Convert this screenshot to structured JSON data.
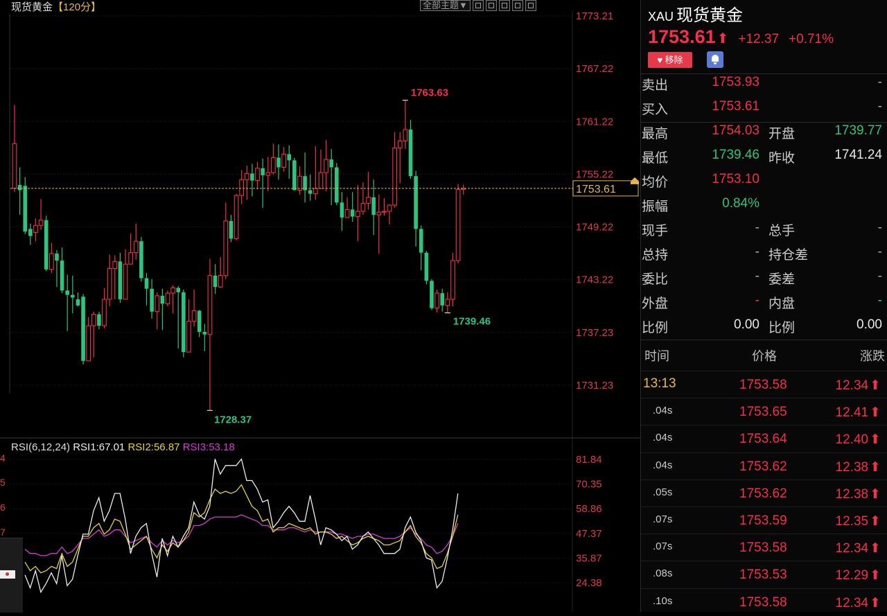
{
  "chart_header": {
    "title": "现货黄金",
    "period": "【120分】",
    "theme_button": "全部主题▼"
  },
  "price_axis_labels": [
    "1773.21",
    "1767.22",
    "1761.22",
    "1755.22",
    "1749.22",
    "1743.22",
    "1737.23",
    "1731.23"
  ],
  "current_price_tag": "1753.61",
  "rsi": {
    "legend": {
      "params": "RSI(6,12,24)",
      "rsi1": "RSI1:67.01",
      "rsi2": "RSI2:56.87",
      "rsi3": "RSI3:53.18"
    },
    "axis_labels": [
      "81.84",
      "70.35",
      "58.86",
      "47.37",
      "35.87",
      "24.38"
    ],
    "cut_left_digits": [
      "4",
      "5",
      "6",
      "7"
    ]
  },
  "chart_data": {
    "type": "candlestick",
    "ylim": [
      1728.0,
      1773.21
    ],
    "current_price": 1753.61,
    "annotations": {
      "high": 1763.63,
      "low": 1728.37,
      "last_low": 1739.46
    },
    "candles": [
      {
        "o": 1753.61,
        "c": 1758.7,
        "h": 1763.1,
        "l": 1753.2
      },
      {
        "o": 1754.0,
        "c": 1753.4,
        "h": 1756.0,
        "l": 1750.6
      },
      {
        "o": 1753.9,
        "c": 1748.7,
        "h": 1754.9,
        "l": 1748.4
      },
      {
        "o": 1749.0,
        "c": 1748.2,
        "h": 1749.6,
        "l": 1747.2
      },
      {
        "o": 1748.6,
        "c": 1749.4,
        "h": 1750.2,
        "l": 1747.6
      },
      {
        "o": 1749.4,
        "c": 1750.0,
        "h": 1752.4,
        "l": 1748.9
      },
      {
        "o": 1750.0,
        "c": 1744.4,
        "h": 1750.5,
        "l": 1744.2
      },
      {
        "o": 1744.4,
        "c": 1746.2,
        "h": 1747.4,
        "l": 1744.0
      },
      {
        "o": 1746.2,
        "c": 1745.4,
        "h": 1746.6,
        "l": 1742.4
      },
      {
        "o": 1745.4,
        "c": 1742.0,
        "h": 1746.9,
        "l": 1741.7
      },
      {
        "o": 1742.0,
        "c": 1741.5,
        "h": 1743.8,
        "l": 1737.4
      },
      {
        "o": 1741.5,
        "c": 1741.2,
        "h": 1743.7,
        "l": 1739.4
      },
      {
        "o": 1741.0,
        "c": 1740.3,
        "h": 1741.8,
        "l": 1740.2
      },
      {
        "o": 1741.3,
        "c": 1734.0,
        "h": 1741.6,
        "l": 1733.6
      },
      {
        "o": 1734.0,
        "c": 1738.0,
        "h": 1739.0,
        "l": 1734.3
      },
      {
        "o": 1738.0,
        "c": 1739.3,
        "h": 1739.6,
        "l": 1734.4
      },
      {
        "o": 1739.3,
        "c": 1738.0,
        "h": 1739.6,
        "l": 1737.6
      },
      {
        "o": 1738.0,
        "c": 1741.0,
        "h": 1742.3,
        "l": 1737.7
      },
      {
        "o": 1741.0,
        "c": 1744.5,
        "h": 1746.1,
        "l": 1740.2
      },
      {
        "o": 1744.5,
        "c": 1745.3,
        "h": 1746.0,
        "l": 1741.0
      },
      {
        "o": 1745.3,
        "c": 1741.0,
        "h": 1746.3,
        "l": 1740.6
      },
      {
        "o": 1741.0,
        "c": 1745.0,
        "h": 1746.7,
        "l": 1741.1
      },
      {
        "o": 1745.0,
        "c": 1746.3,
        "h": 1748.5,
        "l": 1745.0
      },
      {
        "o": 1746.3,
        "c": 1747.6,
        "h": 1749.6,
        "l": 1745.5
      },
      {
        "o": 1747.6,
        "c": 1743.4,
        "h": 1748.1,
        "l": 1743.0
      },
      {
        "o": 1743.4,
        "c": 1742.2,
        "h": 1744.0,
        "l": 1740.3
      },
      {
        "o": 1742.2,
        "c": 1739.6,
        "h": 1743.3,
        "l": 1738.8
      },
      {
        "o": 1739.6,
        "c": 1741.4,
        "h": 1741.8,
        "l": 1737.6
      },
      {
        "o": 1741.4,
        "c": 1740.5,
        "h": 1742.2,
        "l": 1737.5
      },
      {
        "o": 1740.5,
        "c": 1741.7,
        "h": 1742.0,
        "l": 1740.2
      },
      {
        "o": 1741.7,
        "c": 1742.3,
        "h": 1742.6,
        "l": 1739.4
      },
      {
        "o": 1742.3,
        "c": 1741.8,
        "h": 1742.5,
        "l": 1735.4
      },
      {
        "o": 1741.8,
        "c": 1735.0,
        "h": 1742.1,
        "l": 1734.4
      },
      {
        "o": 1735.0,
        "c": 1738.5,
        "h": 1741.0,
        "l": 1735.0
      },
      {
        "o": 1738.5,
        "c": 1739.7,
        "h": 1742.1,
        "l": 1737.9
      },
      {
        "o": 1739.7,
        "c": 1737.3,
        "h": 1739.8,
        "l": 1736.7
      },
      {
        "o": 1737.3,
        "c": 1737.0,
        "h": 1738.2,
        "l": 1735.1
      },
      {
        "o": 1737.0,
        "c": 1743.7,
        "h": 1745.6,
        "l": 1728.37
      },
      {
        "o": 1743.7,
        "c": 1742.4,
        "h": 1745.0,
        "l": 1741.6
      },
      {
        "o": 1742.4,
        "c": 1743.7,
        "h": 1745.8,
        "l": 1742.3
      },
      {
        "o": 1743.7,
        "c": 1749.9,
        "h": 1752.0,
        "l": 1743.3
      },
      {
        "o": 1749.9,
        "c": 1747.9,
        "h": 1750.6,
        "l": 1747.5
      },
      {
        "o": 1747.9,
        "c": 1752.8,
        "h": 1753.0,
        "l": 1747.7
      },
      {
        "o": 1752.8,
        "c": 1754.6,
        "h": 1755.7,
        "l": 1751.8
      },
      {
        "o": 1754.6,
        "c": 1755.3,
        "h": 1756.2,
        "l": 1752.3
      },
      {
        "o": 1755.3,
        "c": 1754.5,
        "h": 1756.4,
        "l": 1752.7
      },
      {
        "o": 1754.5,
        "c": 1755.9,
        "h": 1756.6,
        "l": 1753.5
      },
      {
        "o": 1755.9,
        "c": 1755.1,
        "h": 1757.0,
        "l": 1751.4
      },
      {
        "o": 1755.1,
        "c": 1755.4,
        "h": 1757.2,
        "l": 1753.3
      },
      {
        "o": 1755.4,
        "c": 1757.1,
        "h": 1758.7,
        "l": 1755.2
      },
      {
        "o": 1757.1,
        "c": 1756.0,
        "h": 1758.6,
        "l": 1754.6
      },
      {
        "o": 1756.0,
        "c": 1757.5,
        "h": 1758.3,
        "l": 1755.5
      },
      {
        "o": 1757.5,
        "c": 1756.8,
        "h": 1758.5,
        "l": 1754.7
      },
      {
        "o": 1756.8,
        "c": 1753.4,
        "h": 1757.1,
        "l": 1753.4
      },
      {
        "o": 1753.4,
        "c": 1755.0,
        "h": 1756.1,
        "l": 1752.9
      },
      {
        "o": 1755.0,
        "c": 1753.4,
        "h": 1757.7,
        "l": 1752.0
      },
      {
        "o": 1753.4,
        "c": 1753.0,
        "h": 1755.2,
        "l": 1752.2
      },
      {
        "o": 1753.0,
        "c": 1753.6,
        "h": 1758.4,
        "l": 1752.3
      },
      {
        "o": 1753.6,
        "c": 1755.4,
        "h": 1758.0,
        "l": 1755.1
      },
      {
        "o": 1755.4,
        "c": 1756.9,
        "h": 1759.1,
        "l": 1753.3
      },
      {
        "o": 1756.9,
        "c": 1756.0,
        "h": 1758.1,
        "l": 1751.7
      },
      {
        "o": 1756.0,
        "c": 1752.0,
        "h": 1756.5,
        "l": 1751.7
      },
      {
        "o": 1752.0,
        "c": 1750.3,
        "h": 1753.2,
        "l": 1748.8
      },
      {
        "o": 1750.3,
        "c": 1751.2,
        "h": 1752.6,
        "l": 1750.3
      },
      {
        "o": 1751.2,
        "c": 1750.4,
        "h": 1753.2,
        "l": 1749.8
      },
      {
        "o": 1750.4,
        "c": 1751.0,
        "h": 1754.0,
        "l": 1747.6
      },
      {
        "o": 1751.0,
        "c": 1751.9,
        "h": 1754.3,
        "l": 1750.6
      },
      {
        "o": 1751.9,
        "c": 1752.6,
        "h": 1755.5,
        "l": 1751.2
      },
      {
        "o": 1752.6,
        "c": 1750.6,
        "h": 1754.6,
        "l": 1748.3
      },
      {
        "o": 1750.6,
        "c": 1750.9,
        "h": 1752.9,
        "l": 1746.2
      },
      {
        "o": 1750.9,
        "c": 1751.0,
        "h": 1752.5,
        "l": 1750.5
      },
      {
        "o": 1751.0,
        "c": 1751.7,
        "h": 1751.8,
        "l": 1749.5
      },
      {
        "o": 1751.7,
        "c": 1758.2,
        "h": 1760.0,
        "l": 1751.4
      },
      {
        "o": 1758.2,
        "c": 1759.0,
        "h": 1760.0,
        "l": 1754.2
      },
      {
        "o": 1759.0,
        "c": 1760.3,
        "h": 1763.63,
        "l": 1758.1
      },
      {
        "o": 1760.3,
        "c": 1755.0,
        "h": 1761.4,
        "l": 1754.7
      },
      {
        "o": 1755.0,
        "c": 1749.0,
        "h": 1755.6,
        "l": 1747.0
      },
      {
        "o": 1749.0,
        "c": 1746.3,
        "h": 1749.4,
        "l": 1744.3
      },
      {
        "o": 1746.3,
        "c": 1743.1,
        "h": 1746.5,
        "l": 1742.7
      },
      {
        "o": 1743.1,
        "c": 1740.0,
        "h": 1743.3,
        "l": 1739.8
      },
      {
        "o": 1740.0,
        "c": 1741.7,
        "h": 1742.1,
        "l": 1739.5
      },
      {
        "o": 1741.7,
        "c": 1740.3,
        "h": 1742.2,
        "l": 1739.6
      },
      {
        "o": 1740.3,
        "c": 1741.0,
        "h": 1741.8,
        "l": 1739.46
      },
      {
        "o": 1741.0,
        "c": 1745.4,
        "h": 1746.3,
        "l": 1740.2
      },
      {
        "o": 1745.4,
        "c": 1753.5,
        "h": 1754.1,
        "l": 1745.1
      },
      {
        "o": 1753.5,
        "c": 1753.61,
        "h": 1754.03,
        "l": 1752.9
      }
    ],
    "rsi": {
      "ylim": [
        15,
        85
      ],
      "rsi1": [
        28,
        22,
        30,
        20,
        24,
        29,
        24,
        37,
        23,
        26,
        37,
        47,
        47,
        58,
        64,
        53,
        58,
        66,
        66,
        54,
        38,
        46,
        50,
        52,
        38,
        27,
        45,
        37,
        46,
        41,
        46,
        50,
        62,
        56,
        54,
        60,
        82,
        75,
        79,
        79,
        79,
        82,
        72,
        72,
        68,
        62,
        63,
        50,
        53,
        57,
        60,
        57,
        53,
        53,
        65,
        54,
        42,
        50,
        49,
        47,
        44,
        46,
        40,
        42,
        46,
        48,
        45,
        42,
        38,
        38,
        38,
        40,
        50,
        55,
        48,
        44,
        36,
        35,
        22,
        25,
        36,
        49,
        66
      ],
      "rsi2": [
        34,
        30,
        32,
        29,
        30,
        32,
        31,
        38,
        32,
        34,
        40,
        46,
        46,
        50,
        52,
        47,
        49,
        54,
        53,
        47,
        40,
        42,
        44,
        46,
        40,
        36,
        42,
        39,
        43,
        41,
        44,
        48,
        57,
        55,
        57,
        63,
        68,
        66,
        67,
        66,
        67,
        70,
        65,
        60,
        58,
        53,
        54,
        48,
        50,
        50,
        52,
        51,
        50,
        49,
        50,
        47,
        48,
        48,
        47,
        45,
        46,
        44,
        42,
        43,
        45,
        46,
        45,
        44,
        42,
        42,
        43,
        44,
        48,
        51,
        46,
        43,
        38,
        36,
        31,
        32,
        38,
        46,
        56
      ],
      "rsi3": [
        40,
        38,
        38,
        37,
        37,
        38,
        38,
        41,
        38,
        39,
        42,
        45,
        45,
        47,
        49,
        46,
        47,
        49,
        49,
        46,
        43,
        44,
        45,
        46,
        43,
        41,
        44,
        42,
        44,
        43,
        44,
        46,
        51,
        51,
        52,
        54,
        55,
        55,
        55,
        55,
        55,
        56,
        55,
        54,
        53,
        51,
        51,
        49,
        49,
        49,
        50,
        50,
        49,
        48,
        49,
        48,
        48,
        48,
        48,
        47,
        47,
        46,
        45,
        46,
        46,
        47,
        47,
        46,
        45,
        45,
        45,
        46,
        48,
        50,
        47,
        45,
        42,
        41,
        38,
        39,
        42,
        46,
        52
      ]
    }
  },
  "quote": {
    "code": "XAU",
    "name": "现货黄金",
    "price": "1753.61",
    "change": "+12.37",
    "change_pct": "+0.71%",
    "remove_label": "移除",
    "rows": [
      {
        "l1": "卖出",
        "v1": "1753.93",
        "v1c": "red",
        "l2": "",
        "v2": "-",
        "v2c": "dim"
      },
      {
        "l1": "买入",
        "v1": "1753.61",
        "v1c": "red",
        "l2": "",
        "v2": "-",
        "v2c": "dim"
      },
      {
        "l1": "最高",
        "v1": "1754.03",
        "v1c": "red",
        "l2": "开盘",
        "v2": "1739.77",
        "v2c": "green"
      },
      {
        "l1": "最低",
        "v1": "1739.46",
        "v1c": "green",
        "l2": "昨收",
        "v2": "1741.24",
        "v2c": "white"
      },
      {
        "l1": "均价",
        "v1": "1753.10",
        "v1c": "red",
        "l2": "",
        "v2": "",
        "v2c": "dim"
      },
      {
        "l1": "振幅",
        "v1": "0.84%",
        "v1c": "green",
        "l2": "",
        "v2": "",
        "v2c": "dim"
      },
      {
        "l1": "现手",
        "v1": "-",
        "v1c": "dim",
        "l2": "总手",
        "v2": "-",
        "v2c": "dim"
      },
      {
        "l1": "总持",
        "v1": "-",
        "v1c": "dim",
        "l2": "持仓差",
        "v2": "-",
        "v2c": "dim"
      },
      {
        "l1": "委比",
        "v1": "-",
        "v1c": "dim",
        "l2": "委差",
        "v2": "-",
        "v2c": "dim"
      },
      {
        "l1": "外盘",
        "v1": "-",
        "v1c": "red",
        "l2": "内盘",
        "v2": "-",
        "v2c": "green"
      },
      {
        "l1": "比例",
        "v1": "0.00",
        "v1c": "white",
        "l2": "比例",
        "v2": "0.00",
        "v2c": "white"
      }
    ],
    "ticks_header": {
      "time": "时间",
      "price": "价格",
      "change": "涨跌"
    },
    "ticks": [
      {
        "time": "13:13",
        "price": "1753.58",
        "change": "12.34",
        "major": true
      },
      {
        "time": ".04s",
        "price": "1753.65",
        "change": "12.41",
        "major": false
      },
      {
        "time": ".04s",
        "price": "1753.64",
        "change": "12.40",
        "major": false
      },
      {
        "time": ".04s",
        "price": "1753.62",
        "change": "12.38",
        "major": false
      },
      {
        "time": ".05s",
        "price": "1753.62",
        "change": "12.38",
        "major": false
      },
      {
        "time": ".07s",
        "price": "1753.59",
        "change": "12.35",
        "major": false
      },
      {
        "time": ".07s",
        "price": "1753.58",
        "change": "12.34",
        "major": false
      },
      {
        "time": ".08s",
        "price": "1753.53",
        "change": "12.29",
        "major": false
      },
      {
        "time": ".10s",
        "price": "1753.58",
        "change": "12.34",
        "major": false
      }
    ]
  },
  "colors": {
    "up": "#f4304a",
    "down": "#2ec47e",
    "rsi1": "#eeeeee",
    "rsi2": "#e6d33c",
    "rsi3": "#d43fd4",
    "accent": "#e8b84a"
  }
}
